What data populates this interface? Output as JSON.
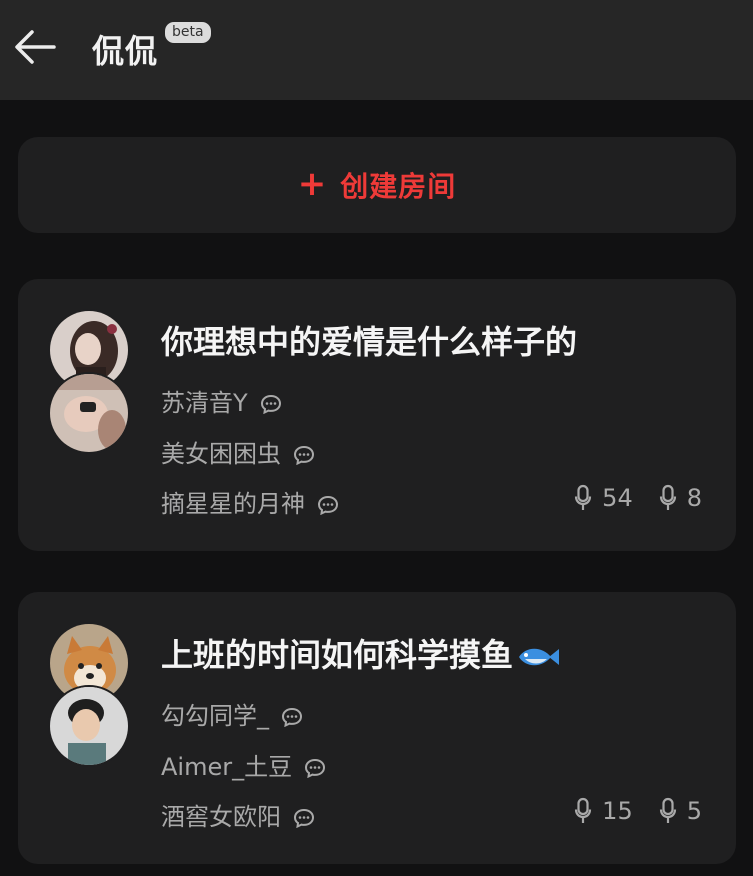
{
  "header": {
    "title": "侃侃",
    "badge": "beta"
  },
  "create_button": {
    "plus": "+",
    "label": "创建房间",
    "color": "#ee3a38"
  },
  "rooms": [
    {
      "title": "你理想中的爱情是什么样子的",
      "speakers": [
        "苏清音Y",
        "美女困困虫",
        "摘星星的月神"
      ],
      "listeners": "54",
      "speaking": "8"
    },
    {
      "title": "上班的时间如何科学摸鱼",
      "title_icon": "fish-icon",
      "speakers": [
        "勾勾同学_",
        "Aimer_土豆",
        "酒窖女欧阳"
      ],
      "listeners": "15",
      "speaking": "5"
    }
  ]
}
